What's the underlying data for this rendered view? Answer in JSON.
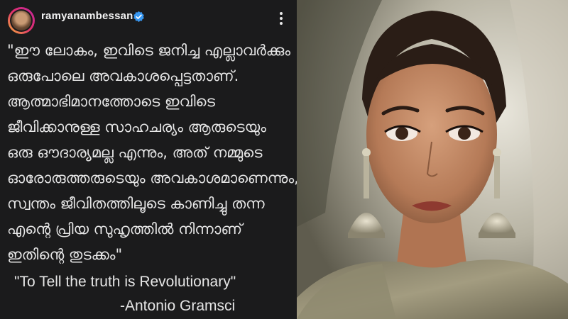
{
  "post": {
    "username": "ramyanambessan",
    "icons": [
      "avatar",
      "verified-badge-icon",
      "more-options-icon"
    ],
    "colors": {
      "background": "#1b1b1c",
      "text": "#e6e6e6",
      "verified": "#3897f0"
    },
    "malayalam_lines": [
      "\"ഈ ലോകം, ഇവിടെ ജനിച്ച എല്ലാവർക്കും",
      "ഒരുപോലെ അവകാശപ്പെട്ടതാണ്.",
      "ആത്മാഭിമാനത്തോടെ ഇവിടെ",
      "ജീവിക്കാനുള്ള സാഹചര്യം ആരുടെയും",
      "ഒരു ഔദാര്യമല്ല എന്നും, അത് നമ്മുടെ",
      "ഓരോരുത്തരുടെയും അവകാശമാണെന്നും,",
      "സ്വന്തം ജീവിതത്തിലൂടെ കാണിച്ചു തന്ന",
      "എന്റെ പ്രിയ സുഹൃത്തിൽ നിന്നാണ്",
      "ഇതിന്റെ തുടക്കം\""
    ],
    "quote": "\"To Tell the truth is Revolutionary\"",
    "attribution": "-Antonio Gramsci"
  }
}
